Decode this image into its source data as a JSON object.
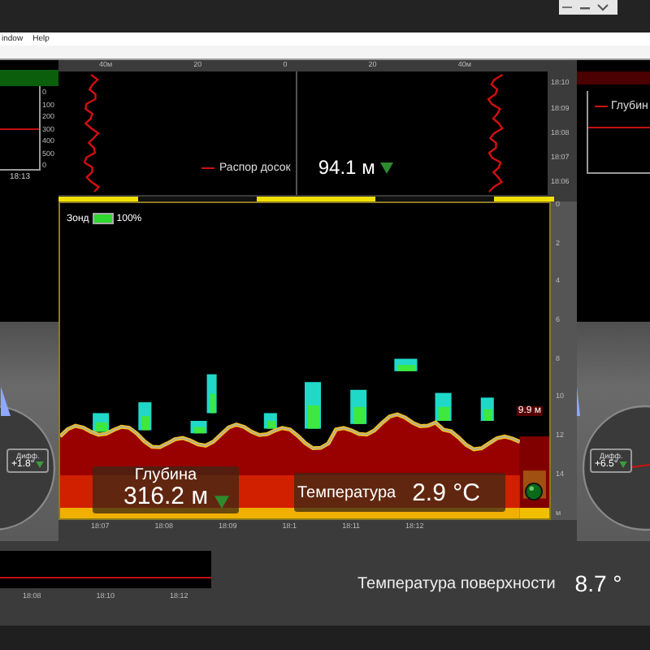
{
  "menu": [
    {
      "label": "indow"
    },
    {
      "label": "Help"
    }
  ],
  "left_chart": {
    "ticks": [
      "0",
      "100",
      "200",
      "300",
      "400",
      "500",
      "0"
    ],
    "time": "18:13"
  },
  "spread_chart": {
    "scale": [
      "40м",
      "20",
      "0",
      "20",
      "40м"
    ],
    "times": [
      "18:10",
      "18:09",
      "18:08",
      "18:07",
      "18:06"
    ],
    "legend": "Распор досок",
    "value": "94.1 м"
  },
  "echogram": {
    "probe_label": "Зонд",
    "battery": {
      "level": 1.0,
      "text": "100%"
    },
    "depth_ticks": [
      "0",
      "2",
      "4",
      "6",
      "8",
      "10",
      "12",
      "14"
    ],
    "depth_unit": "м",
    "bottom_tag": "9.9 м",
    "times": [
      "18:07",
      "18:08",
      "18:09",
      "18:1",
      "18:11",
      "18:12"
    ]
  },
  "depth_readout": {
    "label": "Глубина",
    "value": "316.2 м"
  },
  "temperature_readout": {
    "label": "Температура",
    "value": "2.9 °C"
  },
  "left_gauge": {
    "label": "Дифф.",
    "value": "+1.8°"
  },
  "right_gauge": {
    "label": "Дифф.",
    "value": "+6.5°"
  },
  "right_chart": {
    "legend": "Глубин"
  },
  "bottom_chart": {
    "times": [
      "18:08",
      "18:10",
      "18:12"
    ]
  },
  "surface_temperature": {
    "label": "Температура поверхности",
    "value": "8.7 °"
  }
}
